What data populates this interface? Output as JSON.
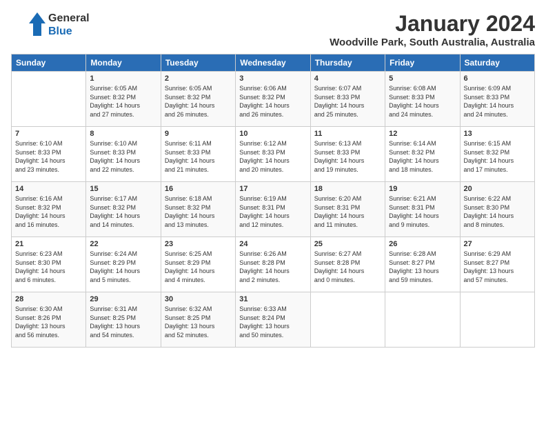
{
  "header": {
    "logo_text_general": "General",
    "logo_text_blue": "Blue",
    "month_title": "January 2024",
    "location": "Woodville Park, South Australia, Australia"
  },
  "calendar": {
    "days_of_week": [
      "Sunday",
      "Monday",
      "Tuesday",
      "Wednesday",
      "Thursday",
      "Friday",
      "Saturday"
    ],
    "weeks": [
      [
        {
          "day": "",
          "info": ""
        },
        {
          "day": "1",
          "info": "Sunrise: 6:05 AM\nSunset: 8:32 PM\nDaylight: 14 hours\nand 27 minutes."
        },
        {
          "day": "2",
          "info": "Sunrise: 6:05 AM\nSunset: 8:32 PM\nDaylight: 14 hours\nand 26 minutes."
        },
        {
          "day": "3",
          "info": "Sunrise: 6:06 AM\nSunset: 8:32 PM\nDaylight: 14 hours\nand 26 minutes."
        },
        {
          "day": "4",
          "info": "Sunrise: 6:07 AM\nSunset: 8:33 PM\nDaylight: 14 hours\nand 25 minutes."
        },
        {
          "day": "5",
          "info": "Sunrise: 6:08 AM\nSunset: 8:33 PM\nDaylight: 14 hours\nand 24 minutes."
        },
        {
          "day": "6",
          "info": "Sunrise: 6:09 AM\nSunset: 8:33 PM\nDaylight: 14 hours\nand 24 minutes."
        }
      ],
      [
        {
          "day": "7",
          "info": "Sunrise: 6:10 AM\nSunset: 8:33 PM\nDaylight: 14 hours\nand 23 minutes."
        },
        {
          "day": "8",
          "info": "Sunrise: 6:10 AM\nSunset: 8:33 PM\nDaylight: 14 hours\nand 22 minutes."
        },
        {
          "day": "9",
          "info": "Sunrise: 6:11 AM\nSunset: 8:33 PM\nDaylight: 14 hours\nand 21 minutes."
        },
        {
          "day": "10",
          "info": "Sunrise: 6:12 AM\nSunset: 8:33 PM\nDaylight: 14 hours\nand 20 minutes."
        },
        {
          "day": "11",
          "info": "Sunrise: 6:13 AM\nSunset: 8:33 PM\nDaylight: 14 hours\nand 19 minutes."
        },
        {
          "day": "12",
          "info": "Sunrise: 6:14 AM\nSunset: 8:32 PM\nDaylight: 14 hours\nand 18 minutes."
        },
        {
          "day": "13",
          "info": "Sunrise: 6:15 AM\nSunset: 8:32 PM\nDaylight: 14 hours\nand 17 minutes."
        }
      ],
      [
        {
          "day": "14",
          "info": "Sunrise: 6:16 AM\nSunset: 8:32 PM\nDaylight: 14 hours\nand 16 minutes."
        },
        {
          "day": "15",
          "info": "Sunrise: 6:17 AM\nSunset: 8:32 PM\nDaylight: 14 hours\nand 14 minutes."
        },
        {
          "day": "16",
          "info": "Sunrise: 6:18 AM\nSunset: 8:32 PM\nDaylight: 14 hours\nand 13 minutes."
        },
        {
          "day": "17",
          "info": "Sunrise: 6:19 AM\nSunset: 8:31 PM\nDaylight: 14 hours\nand 12 minutes."
        },
        {
          "day": "18",
          "info": "Sunrise: 6:20 AM\nSunset: 8:31 PM\nDaylight: 14 hours\nand 11 minutes."
        },
        {
          "day": "19",
          "info": "Sunrise: 6:21 AM\nSunset: 8:31 PM\nDaylight: 14 hours\nand 9 minutes."
        },
        {
          "day": "20",
          "info": "Sunrise: 6:22 AM\nSunset: 8:30 PM\nDaylight: 14 hours\nand 8 minutes."
        }
      ],
      [
        {
          "day": "21",
          "info": "Sunrise: 6:23 AM\nSunset: 8:30 PM\nDaylight: 14 hours\nand 6 minutes."
        },
        {
          "day": "22",
          "info": "Sunrise: 6:24 AM\nSunset: 8:29 PM\nDaylight: 14 hours\nand 5 minutes."
        },
        {
          "day": "23",
          "info": "Sunrise: 6:25 AM\nSunset: 8:29 PM\nDaylight: 14 hours\nand 4 minutes."
        },
        {
          "day": "24",
          "info": "Sunrise: 6:26 AM\nSunset: 8:28 PM\nDaylight: 14 hours\nand 2 minutes."
        },
        {
          "day": "25",
          "info": "Sunrise: 6:27 AM\nSunset: 8:28 PM\nDaylight: 14 hours\nand 0 minutes."
        },
        {
          "day": "26",
          "info": "Sunrise: 6:28 AM\nSunset: 8:27 PM\nDaylight: 13 hours\nand 59 minutes."
        },
        {
          "day": "27",
          "info": "Sunrise: 6:29 AM\nSunset: 8:27 PM\nDaylight: 13 hours\nand 57 minutes."
        }
      ],
      [
        {
          "day": "28",
          "info": "Sunrise: 6:30 AM\nSunset: 8:26 PM\nDaylight: 13 hours\nand 56 minutes."
        },
        {
          "day": "29",
          "info": "Sunrise: 6:31 AM\nSunset: 8:25 PM\nDaylight: 13 hours\nand 54 minutes."
        },
        {
          "day": "30",
          "info": "Sunrise: 6:32 AM\nSunset: 8:25 PM\nDaylight: 13 hours\nand 52 minutes."
        },
        {
          "day": "31",
          "info": "Sunrise: 6:33 AM\nSunset: 8:24 PM\nDaylight: 13 hours\nand 50 minutes."
        },
        {
          "day": "",
          "info": ""
        },
        {
          "day": "",
          "info": ""
        },
        {
          "day": "",
          "info": ""
        }
      ]
    ]
  }
}
